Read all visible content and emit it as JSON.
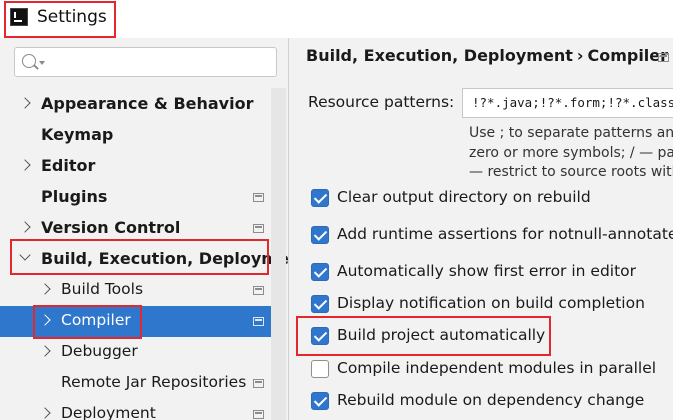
{
  "window": {
    "title": "Settings",
    "app_icon": "intellij-icon"
  },
  "search": {
    "placeholder": "",
    "value": ""
  },
  "tree": {
    "items": [
      {
        "label": "Appearance & Behavior",
        "expandable": true,
        "bold": true,
        "project_icon": false
      },
      {
        "label": "Keymap",
        "expandable": false,
        "bold": true,
        "project_icon": false
      },
      {
        "label": "Editor",
        "expandable": true,
        "bold": true,
        "project_icon": false
      },
      {
        "label": "Plugins",
        "expandable": false,
        "bold": true,
        "project_icon": true
      },
      {
        "label": "Version Control",
        "expandable": true,
        "bold": true,
        "project_icon": true
      },
      {
        "label": "Build, Execution, Deployme",
        "expandable": true,
        "expanded": true,
        "bold": true,
        "project_icon": false
      },
      {
        "label": "Build Tools",
        "expandable": true,
        "bold": false,
        "project_icon": true
      },
      {
        "label": "Compiler",
        "expandable": true,
        "bold": false,
        "project_icon": true,
        "selected": true
      },
      {
        "label": "Debugger",
        "expandable": true,
        "bold": false,
        "project_icon": false
      },
      {
        "label": "Remote Jar Repositories",
        "expandable": false,
        "bold": false,
        "project_icon": true
      },
      {
        "label": "Deployment",
        "expandable": true,
        "bold": false,
        "project_icon": true
      }
    ]
  },
  "breadcrumb": {
    "parent": "Build, Execution, Deployment",
    "separator": "›",
    "current": "Compiler"
  },
  "resource_patterns": {
    "label": "Resource patterns:",
    "value": "!?*.java;!?*.form;!?*.class;!?*.groovy;!?*.scala;!?*.flex;!?*.kt;!?*.clj;!?*.aj",
    "hint_lines": [
      "Use ; to separate patterns and",
      "zero or more symbols; / — pat",
      "— restrict to source roots with"
    ]
  },
  "options": [
    {
      "label": "Clear output directory on rebuild",
      "checked": true
    },
    {
      "label": "Add runtime assertions for notnull-annotate",
      "checked": true
    },
    {
      "label": "Automatically show first error in editor",
      "checked": true
    },
    {
      "label": "Display notification on build completion",
      "checked": true
    },
    {
      "label": "Build project automatically",
      "checked": true
    },
    {
      "label": "Compile independent modules in parallel",
      "checked": false
    },
    {
      "label": "Rebuild module on dependency change",
      "checked": true
    }
  ],
  "colors": {
    "accent": "#2f76cd",
    "highlight_box": "#e0282e",
    "panel_bg": "#f2f2f2"
  }
}
